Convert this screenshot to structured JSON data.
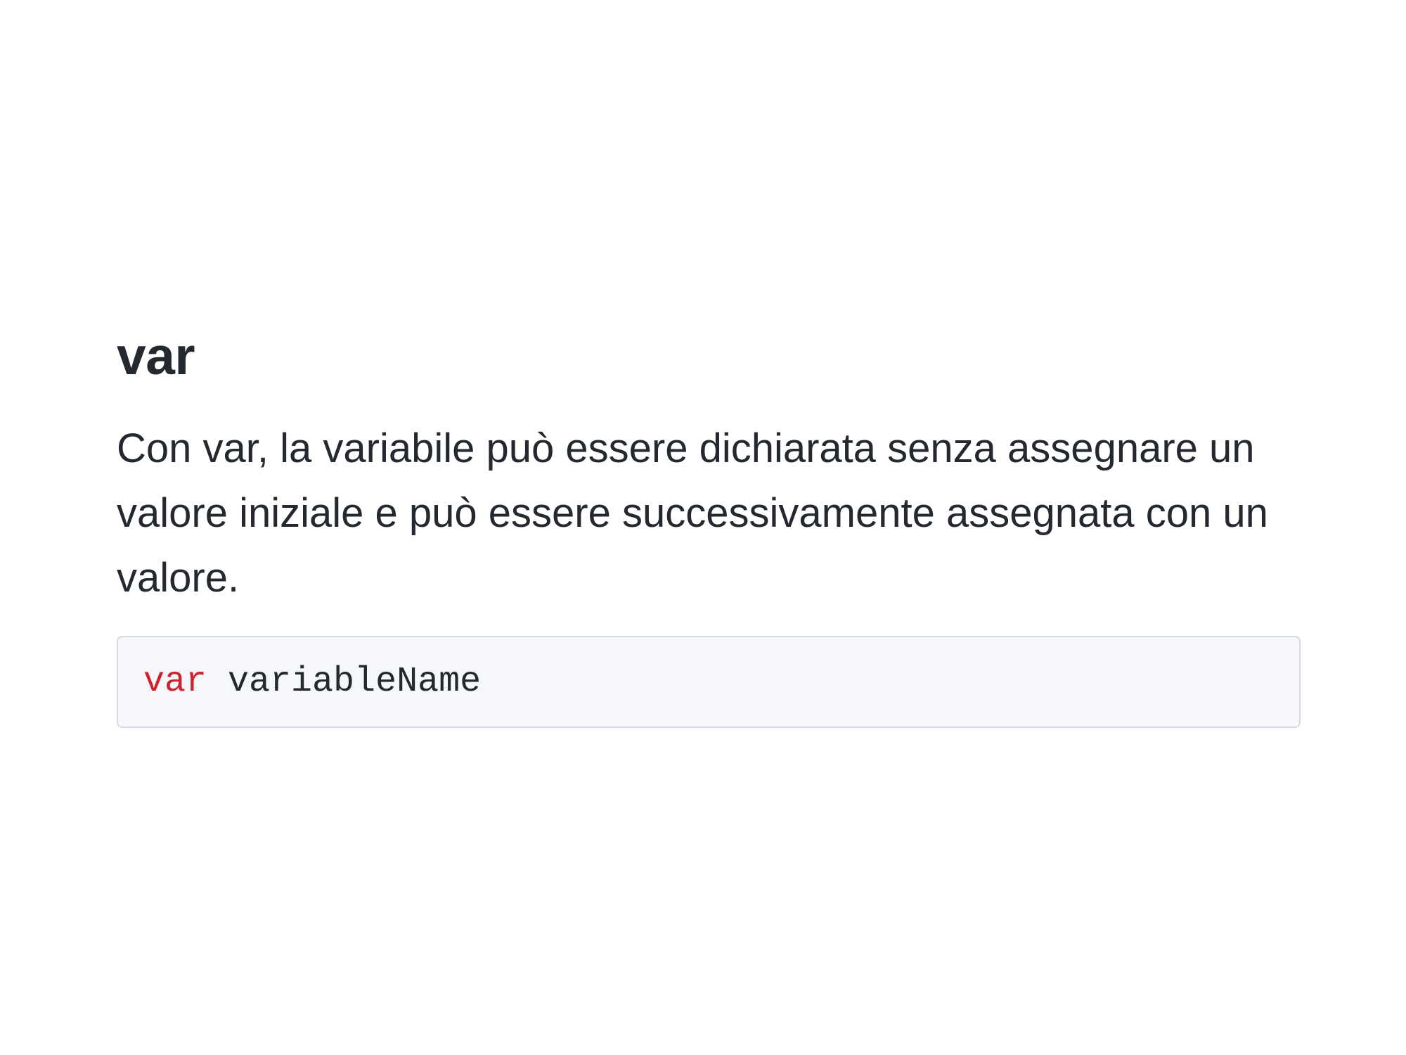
{
  "section": {
    "title": "var",
    "description": "Con var, la variabile può essere dichiarata senza assegnare un valore iniziale e può essere successivamente assegnata con un valore."
  },
  "code": {
    "keyword": "var",
    "identifier": "variableName"
  },
  "colors": {
    "text": "#24292f",
    "keyword": "#cf222e",
    "code_background": "#f6f7fa",
    "code_border": "#d6d9e0"
  }
}
